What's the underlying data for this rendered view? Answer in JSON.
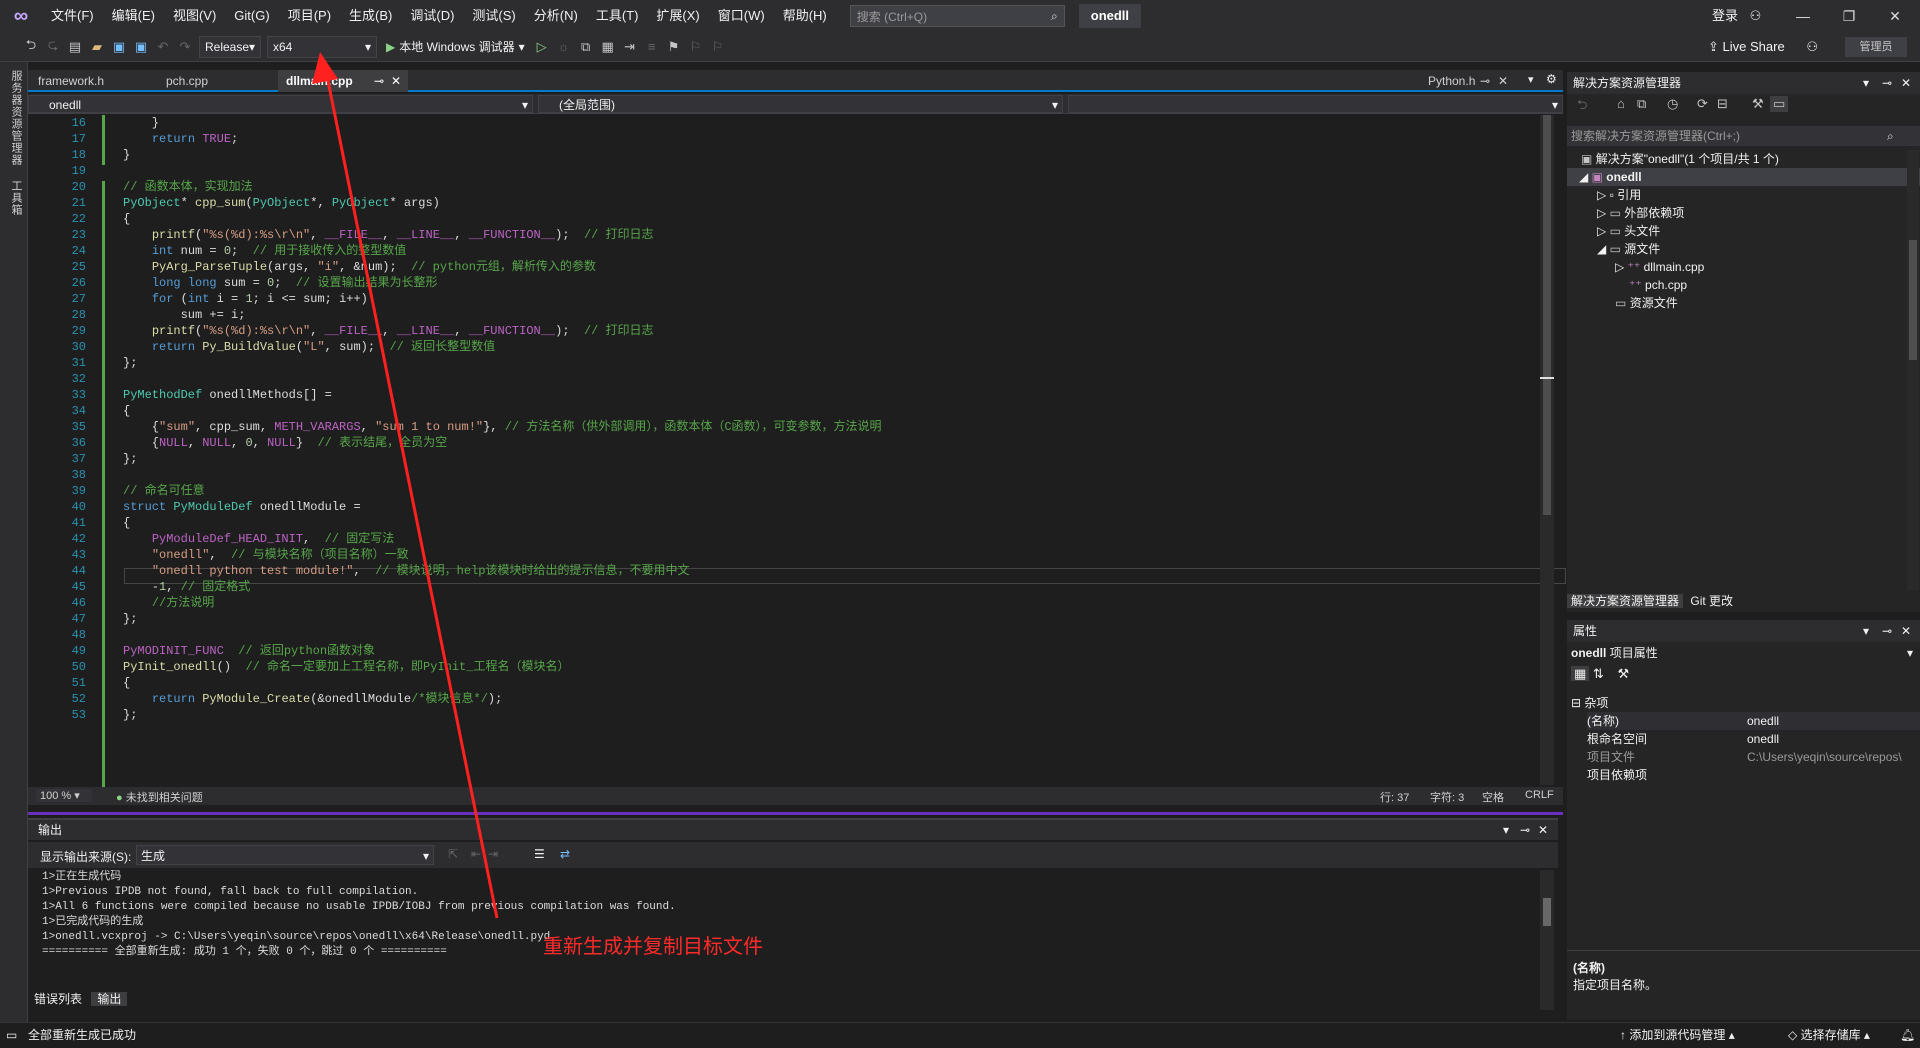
{
  "menubar": {
    "items": [
      "文件(F)",
      "编辑(E)",
      "视图(V)",
      "Git(G)",
      "项目(P)",
      "生成(B)",
      "调试(D)",
      "测试(S)",
      "分析(N)",
      "工具(T)",
      "扩展(X)",
      "窗口(W)",
      "帮助(H)"
    ],
    "search_placeholder": "搜索 (Ctrl+Q)",
    "solution_name": "onedll",
    "login": "登录"
  },
  "toolbar": {
    "config": "Release",
    "platform": "x64",
    "debugger": "本地 Windows 调试器",
    "live_share": "Live Share",
    "admin": "管理员"
  },
  "left_strip": {
    "tab1": "服务器资源管理器",
    "tab2": "工具箱"
  },
  "tabs": {
    "items": [
      "framework.h",
      "pch.cpp",
      "dllmain.cpp"
    ],
    "right_tab": "Python.h"
  },
  "navbar": {
    "project": "onedll",
    "scope": "(全局范围)"
  },
  "code": {
    "lines": [
      {
        "n": "16",
        "html": "    }"
      },
      {
        "n": "17",
        "html": "    <span class=\"k\">return</span> <span class=\"m\">TRUE</span>;"
      },
      {
        "n": "18",
        "html": "}"
      },
      {
        "n": "19",
        "html": ""
      },
      {
        "n": "20",
        "html": "<span class=\"c\">// 函数本体，实现加法</span>"
      },
      {
        "n": "21",
        "html": "<span class=\"t\">PyObject</span>* <span class=\"f\">cpp_sum</span>(<span class=\"t\">PyObject</span>*, <span class=\"t\">PyObject</span>* args)"
      },
      {
        "n": "22",
        "html": "{"
      },
      {
        "n": "23",
        "html": "    <span class=\"f\">printf</span>(<span class=\"s\">\"%s(%d):%s\\r\\n\"</span>, <span class=\"m\">__FILE__</span>, <span class=\"m\">__LINE__</span>, <span class=\"m\">__FUNCTION__</span>);  <span class=\"c\">// 打印日志</span>"
      },
      {
        "n": "24",
        "html": "    <span class=\"k\">int</span> num = <span class=\"n\">0</span>;  <span class=\"c\">// 用于接收传入的整型数值</span>"
      },
      {
        "n": "25",
        "html": "    <span class=\"f\">PyArg_ParseTuple</span>(args, <span class=\"s\">\"i\"</span>, &amp;num);  <span class=\"c\">// python元组，解析传入的参数</span>"
      },
      {
        "n": "26",
        "html": "    <span class=\"k\">long long</span> sum = <span class=\"n\">0</span>;  <span class=\"c\">// 设置输出结果为长整形</span>"
      },
      {
        "n": "27",
        "html": "    <span class=\"k\">for</span> (<span class=\"k\">int</span> i = <span class=\"n\">1</span>; i &lt;= sum; i++)"
      },
      {
        "n": "28",
        "html": "        sum += i;"
      },
      {
        "n": "29",
        "html": "    <span class=\"f\">printf</span>(<span class=\"s\">\"%s(%d):%s\\r\\n\"</span>, <span class=\"m\">__FILE__</span>, <span class=\"m\">__LINE__</span>, <span class=\"m\">__FUNCTION__</span>);  <span class=\"c\">// 打印日志</span>"
      },
      {
        "n": "30",
        "html": "    <span class=\"k\">return</span> <span class=\"f\">Py_BuildValue</span>(<span class=\"s\">\"L\"</span>, sum);  <span class=\"c\">// 返回长整型数值</span>"
      },
      {
        "n": "31",
        "html": "};"
      },
      {
        "n": "32",
        "html": ""
      },
      {
        "n": "33",
        "html": "<span class=\"t\">PyMethodDef</span> onedllMethods[] ="
      },
      {
        "n": "34",
        "html": "{"
      },
      {
        "n": "35",
        "html": "    {<span class=\"s\">\"sum\"</span>, cpp_sum, <span class=\"m\">METH_VARARGS</span>, <span class=\"s\">\"sum 1 to num!\"</span>}, <span class=\"c\">// 方法名称（供外部调用），函数本体（C函数），可变参数，方法说明</span>"
      },
      {
        "n": "36",
        "html": "    {<span class=\"m\">NULL</span>, <span class=\"m\">NULL</span>, <span class=\"n\">0</span>, <span class=\"m\">NULL</span>}  <span class=\"c\">// 表示结尾，全员为空</span>"
      },
      {
        "n": "37",
        "html": "};"
      },
      {
        "n": "38",
        "html": ""
      },
      {
        "n": "39",
        "html": "<span class=\"c\">// 命名可任意</span>"
      },
      {
        "n": "40",
        "html": "<span class=\"k\">struct</span> <span class=\"t\">PyModuleDef</span> onedllModule ="
      },
      {
        "n": "41",
        "html": "{"
      },
      {
        "n": "42",
        "html": "    <span class=\"m\">PyModuleDef_HEAD_INIT</span>,  <span class=\"c\">// 固定写法</span>"
      },
      {
        "n": "43",
        "html": "    <span class=\"s\">\"onedll\"</span>,  <span class=\"c\">// 与模块名称（项目名称）一致</span>"
      },
      {
        "n": "44",
        "html": "    <span class=\"s\">\"onedll python test module!\"</span>,  <span class=\"c\">// 模块说明，help该模块时给出的提示信息，不要用中文</span>"
      },
      {
        "n": "45",
        "html": "    -<span class=\"n\">1</span>, <span class=\"c\">// 固定格式</span>"
      },
      {
        "n": "46",
        "html": "    <span class=\"c\">//方法说明</span>"
      },
      {
        "n": "47",
        "html": "};"
      },
      {
        "n": "48",
        "html": ""
      },
      {
        "n": "49",
        "html": "<span class=\"m\">PyMODINIT_FUNC</span>  <span class=\"c\">// 返回python函数对象</span>"
      },
      {
        "n": "50",
        "html": "<span class=\"f\">PyInit_onedll</span>()  <span class=\"c\">// 命名一定要加上工程名称，即PyInit_工程名（模块名）</span>"
      },
      {
        "n": "51",
        "html": "{"
      },
      {
        "n": "52",
        "html": "    <span class=\"k\">return</span> <span class=\"f\">PyModule_Create</span>(&amp;onedllModule<span class=\"c\">/*模块信息*/</span>);"
      },
      {
        "n": "53",
        "html": "};"
      }
    ]
  },
  "editor_status": {
    "zoom": "100 %",
    "issues": "未找到相关问题",
    "line": "行: 37",
    "char": "字符: 3",
    "spaces": "空格",
    "eol": "CRLF"
  },
  "output": {
    "title": "输出",
    "source_label": "显示输出来源(S):",
    "source_value": "生成",
    "lines": [
      "1>正在生成代码",
      "1>Previous IPDB not found, fall back to full compilation.",
      "1>All 6 functions were compiled because no usable IPDB/IOBJ from previous compilation was found.",
      "1>已完成代码的生成",
      "1>onedll.vcxproj -> C:\\Users\\yeqin\\source\\repos\\onedll\\x64\\Release\\onedll.pyd",
      "========== 全部重新生成: 成功 1 个，失败 0 个，跳过 0 个 =========="
    ],
    "tabs": [
      "错误列表",
      "输出"
    ]
  },
  "annotation": "重新生成并复制目标文件",
  "solution_explorer": {
    "title": "解决方案资源管理器",
    "search": "搜索解决方案资源管理器(Ctrl+;)",
    "solution": "解决方案\"onedll\"(1 个项目/共 1 个)",
    "project": "onedll",
    "items": [
      "引用",
      "外部依赖项",
      "头文件",
      "源文件",
      "dllmain.cpp",
      "pch.cpp",
      "资源文件"
    ],
    "bottom_tabs": [
      "解决方案资源管理器",
      "Git 更改"
    ]
  },
  "properties": {
    "title": "属性",
    "subject": "onedll",
    "subject_type": "项目属性",
    "category": "杂项",
    "rows": [
      {
        "name": "(名称)",
        "value": "onedll"
      },
      {
        "name": "根命名空间",
        "value": "onedll"
      },
      {
        "name": "项目文件",
        "value": "C:\\Users\\yeqin\\source\\repos\\"
      },
      {
        "name": "项目依赖项",
        "value": ""
      }
    ],
    "desc_title": "(名称)",
    "desc_text": "指定项目名称。"
  },
  "statusbar": {
    "message": "全部重新生成已成功",
    "source_control": "添加到源代码管理",
    "repo": "选择存储库"
  }
}
